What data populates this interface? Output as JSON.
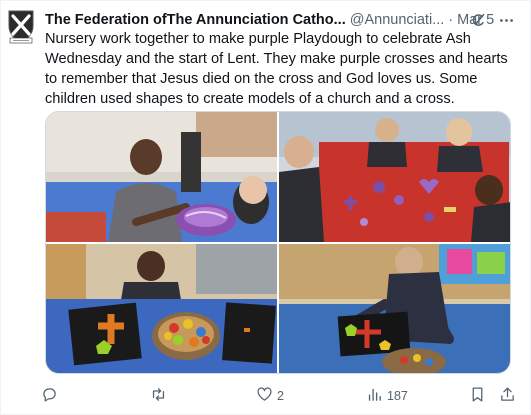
{
  "tweet": {
    "author_name": "The Federation ofThe Annunciation Catho...",
    "handle": "@Annunciati...",
    "separator": "·",
    "date": "Mar 5",
    "text": "Nursery work together to make purple Playdough to celebrate Ash Wednesday and the start of Lent. They make purple crosses and hearts to remember that Jesus died on the cross and God loves us. Some children used shapes to create models of a church and a cross."
  },
  "icons": {
    "avatar": "school-crest-logo",
    "grok": "grok-icon",
    "more": "more-icon",
    "reply": "reply-icon",
    "retweet": "retweet-icon",
    "like": "heart-icon",
    "views": "views-icon",
    "bookmark": "bookmark-icon",
    "share": "share-icon"
  },
  "stats": {
    "reply_count": "",
    "retweet_count": "",
    "like_count": "2",
    "view_count": "187"
  },
  "colors": {
    "text": "#0f1419",
    "secondary": "#536471",
    "border": "#cfd9de",
    "playdough_purple": "#7b4fa6",
    "table_red": "#c8342b",
    "table_blue": "#3b6fb8"
  }
}
